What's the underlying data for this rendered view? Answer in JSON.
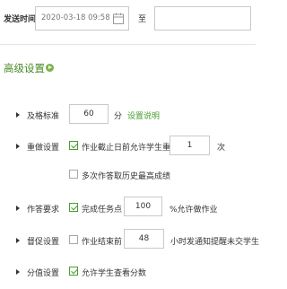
{
  "filter": {
    "send_time_label": "发送时间",
    "start_date": "2020-03-18 09:58",
    "to_label": "至",
    "end_date": ""
  },
  "advanced": {
    "title": "高级设置"
  },
  "settings": {
    "pass": {
      "label": "及格标准",
      "value": "60",
      "unit": "分",
      "link": "设置说明"
    },
    "redo": {
      "label": "重做设置",
      "option1_text": "作业截止日前允许学生重做",
      "option1_checked": true,
      "count": "1",
      "count_unit": "次",
      "option2_text": "多次作答取历史最高成绩",
      "option2_checked": false
    },
    "requirement": {
      "label": "作答要求",
      "checkbox_text": "完成任务点",
      "checked": true,
      "value": "100",
      "suffix": "%允许做作业"
    },
    "urge": {
      "label": "督促设置",
      "checkbox_text": "作业结束前",
      "checked": false,
      "value": "48",
      "suffix": "小时发通知提醒未交学生"
    },
    "score": {
      "label": "分值设置",
      "checkbox_text": "允许学生查看分数",
      "checked": true
    }
  }
}
